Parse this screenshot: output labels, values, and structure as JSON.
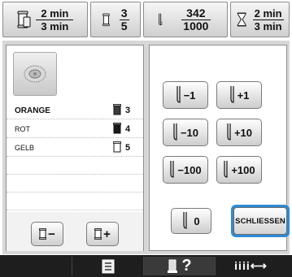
{
  "status": {
    "time_remaining_top": "2 min",
    "time_remaining_bottom": "3 min",
    "color_current": "3",
    "color_total": "5",
    "stitch_current": "342",
    "stitch_total": "1000",
    "total_time_top": "2 min",
    "total_time_bottom": "3 min"
  },
  "thread_list": [
    {
      "name": "ORANGE",
      "number": "3",
      "selected": true,
      "spool_color": "#3b3b3b"
    },
    {
      "name": "ROT",
      "number": "4",
      "selected": false,
      "spool_color": "#1a1a1a"
    },
    {
      "name": "GELB",
      "number": "5",
      "selected": false,
      "spool_color": "#ffffff"
    }
  ],
  "controls": {
    "spool_minus": "−",
    "spool_plus": "+",
    "step_minus_1": "−1",
    "step_plus_1": "+1",
    "step_minus_10": "−10",
    "step_plus_10": "+10",
    "step_minus_100": "−100",
    "step_plus_100": "+100",
    "zero": "0",
    "close": "SCHLIESSEN"
  },
  "bottom_nav": {
    "help_label": "?",
    "tension_label": "iiii⟷"
  },
  "icons": {
    "time": "spool-clock-icon",
    "color": "thread-spool-icon",
    "stitch": "needle-icon",
    "total": "hourglass-icon",
    "preview": "embroidery-preview-icon",
    "list": "list-icon",
    "help": "help-icon",
    "tension": "tension-icon"
  },
  "colors": {
    "accent": "#2d8bd6",
    "bottom_bar": "#1e1e1e",
    "panel_bg": "#d7d7d7"
  }
}
